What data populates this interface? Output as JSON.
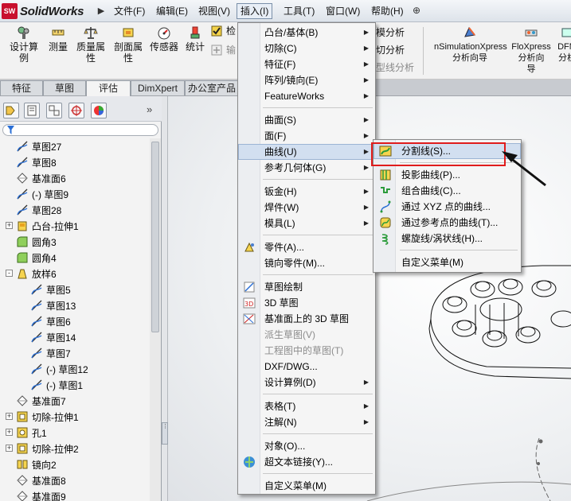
{
  "app": {
    "brand_prefix": "SW",
    "brand": "SolidWorks"
  },
  "menubar": [
    {
      "label": "文件(F)"
    },
    {
      "label": "编辑(E)"
    },
    {
      "label": "视图(V)"
    },
    {
      "label": "插入(I)"
    },
    {
      "label": "工具(T)"
    },
    {
      "label": "窗口(W)"
    },
    {
      "label": "帮助(H)"
    }
  ],
  "toolbar": {
    "items": [
      {
        "label": "设计算\n例",
        "icon": "design-study-icon"
      },
      {
        "label": "测量",
        "icon": "measure-icon"
      },
      {
        "label": "质量属\n性",
        "icon": "mass-properties-icon"
      },
      {
        "label": "剖面属\n性",
        "icon": "section-properties-icon"
      },
      {
        "label": "传感器",
        "icon": "sensor-icon"
      },
      {
        "label": "统计",
        "icon": "statistics-icon"
      },
      {
        "label": "检",
        "icon": "check-icon"
      },
      {
        "label": "输",
        "icon": "import-icon"
      }
    ],
    "partial_right": [
      "模分析",
      "切分析",
      "型线分析"
    ],
    "sim_items": [
      {
        "label": "nSimulationXpress\n分析向导",
        "icon": "simulation-icon"
      },
      {
        "label": "FloXpress\n分析向\n导",
        "icon": "floxpress-icon"
      },
      {
        "label": "DFM\n分析",
        "icon": "dfm-icon"
      }
    ]
  },
  "tabs": [
    "特征",
    "草图",
    "评估",
    "DimXpert",
    "办公室产品"
  ],
  "tree": [
    {
      "label": "草图27",
      "icon": "sketch-icon",
      "indent": 1
    },
    {
      "label": "草图8",
      "icon": "sketch-icon",
      "indent": 1
    },
    {
      "label": "基准面6",
      "icon": "plane-icon",
      "indent": 1
    },
    {
      "label": "(-) 草图9",
      "icon": "sketch-icon",
      "indent": 1
    },
    {
      "label": "草图28",
      "icon": "sketch-icon",
      "indent": 1
    },
    {
      "label": "凸台-拉伸1",
      "icon": "boss-extrude-icon",
      "indent": 1,
      "toggle": "+"
    },
    {
      "label": "圆角3",
      "icon": "fillet-icon",
      "indent": 1
    },
    {
      "label": "圆角4",
      "icon": "fillet-icon",
      "indent": 1
    },
    {
      "label": "放样6",
      "icon": "loft-icon",
      "indent": 1,
      "toggle": "-"
    },
    {
      "label": "草图5",
      "icon": "sketch-icon",
      "indent": 2
    },
    {
      "label": "草图13",
      "icon": "sketch-icon",
      "indent": 2
    },
    {
      "label": "草图6",
      "icon": "sketch-icon",
      "indent": 2
    },
    {
      "label": "草图14",
      "icon": "sketch-icon",
      "indent": 2
    },
    {
      "label": "草图7",
      "icon": "sketch-icon",
      "indent": 2
    },
    {
      "label": "(-) 草图12",
      "icon": "sketch-icon",
      "indent": 2
    },
    {
      "label": "(-) 草图1",
      "icon": "sketch-icon",
      "indent": 2
    },
    {
      "label": "基准面7",
      "icon": "plane-icon",
      "indent": 1
    },
    {
      "label": "切除-拉伸1",
      "icon": "cut-extrude-icon",
      "indent": 1,
      "toggle": "+"
    },
    {
      "label": "孔1",
      "icon": "hole-icon",
      "indent": 1,
      "toggle": "+"
    },
    {
      "label": "切除-拉伸2",
      "icon": "cut-extrude-icon",
      "indent": 1,
      "toggle": "+"
    },
    {
      "label": "镜向2",
      "icon": "mirror-icon",
      "indent": 1
    },
    {
      "label": "基准面8",
      "icon": "plane-icon",
      "indent": 1
    },
    {
      "label": "基准面9",
      "icon": "plane-icon",
      "indent": 1
    }
  ],
  "menu": {
    "items": [
      {
        "label": "凸台/基体(B)",
        "submenu": true
      },
      {
        "label": "切除(C)",
        "submenu": true
      },
      {
        "label": "特征(F)",
        "submenu": true
      },
      {
        "label": "阵列/镜向(E)",
        "submenu": true
      },
      {
        "label": "FeatureWorks",
        "submenu": true
      },
      {
        "sep": true
      },
      {
        "label": "曲面(S)",
        "submenu": true
      },
      {
        "label": "面(F)",
        "submenu": true
      },
      {
        "label": "曲线(U)",
        "submenu": true,
        "highlight": true
      },
      {
        "label": "参考几何体(G)",
        "submenu": true
      },
      {
        "sep": true
      },
      {
        "label": "钣金(H)",
        "submenu": true
      },
      {
        "label": "焊件(W)",
        "submenu": true
      },
      {
        "label": "模具(L)",
        "submenu": true
      },
      {
        "sep": true
      },
      {
        "label": "零件(A)...",
        "icon": "part-icon"
      },
      {
        "label": "镜向零件(M)..."
      },
      {
        "sep": true
      },
      {
        "label": "草图绘制",
        "icon": "sketch-draw-icon"
      },
      {
        "label": "3D 草图",
        "icon": "3d-sketch-icon"
      },
      {
        "label": "基准面上的 3D 草图",
        "icon": "3d-sketch-plane-icon"
      },
      {
        "label": "派生草图(V)",
        "disabled": true
      },
      {
        "label": "工程图中的草图(T)",
        "disabled": true
      },
      {
        "label": "DXF/DWG..."
      },
      {
        "label": "设计算例(D)",
        "submenu": true
      },
      {
        "sep": true
      },
      {
        "label": "表格(T)",
        "submenu": true
      },
      {
        "label": "注解(N)",
        "submenu": true
      },
      {
        "sep": true
      },
      {
        "label": "对象(O)..."
      },
      {
        "label": "超文本链接(Y)...",
        "icon": "hyperlink-icon"
      },
      {
        "sep": true
      },
      {
        "label": "自定义菜单(M)"
      }
    ]
  },
  "submenu": {
    "items": [
      {
        "label": "分割线(S)...",
        "icon": "split-line-icon",
        "highlight": true
      },
      {
        "sep": true
      },
      {
        "label": "投影曲线(P)...",
        "icon": "projected-curve-icon"
      },
      {
        "label": "组合曲线(C)...",
        "icon": "composite-curve-icon"
      },
      {
        "label": "通过 XYZ 点的曲线...",
        "icon": "curve-xyz-icon"
      },
      {
        "label": "通过参考点的曲线(T)...",
        "icon": "curve-ref-points-icon"
      },
      {
        "label": "螺旋线/涡状线(H)...",
        "icon": "helix-icon"
      },
      {
        "sep": true
      },
      {
        "label": "自定义菜单(M)"
      }
    ]
  },
  "colors": {
    "highlight": "#d2dff0",
    "annotation": "#e01c1c",
    "brand": "#c8102e"
  }
}
